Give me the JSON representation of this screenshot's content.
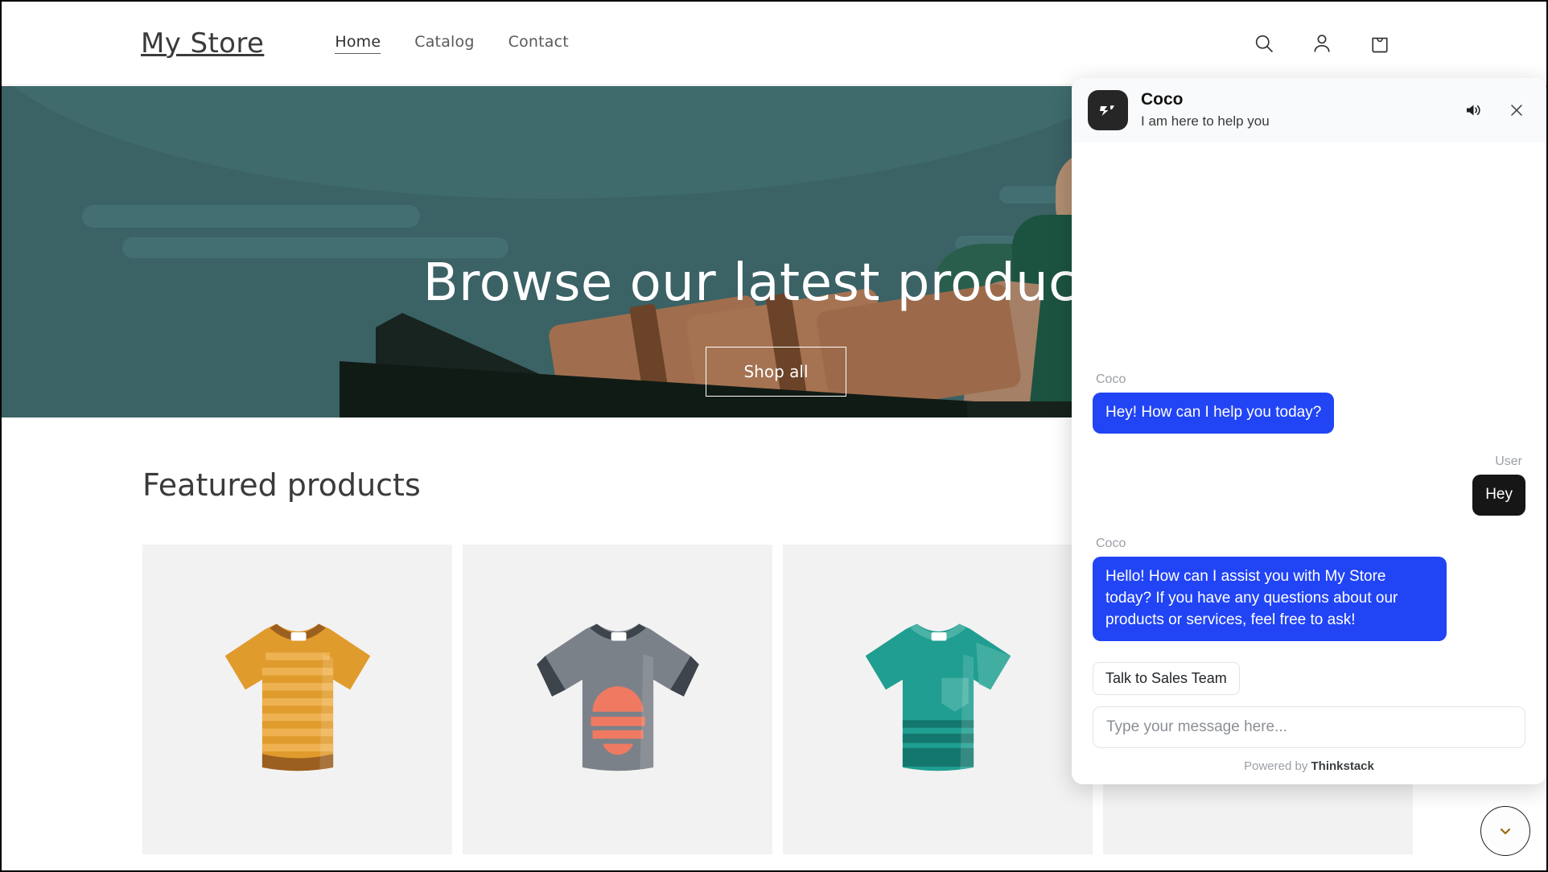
{
  "site": {
    "brand": "My Store",
    "nav": [
      {
        "label": "Home",
        "active": true
      },
      {
        "label": "Catalog",
        "active": false
      },
      {
        "label": "Contact",
        "active": false
      }
    ],
    "actions": [
      {
        "name": "search-icon",
        "label": "Search"
      },
      {
        "name": "account-icon",
        "label": "Log in"
      },
      {
        "name": "cart-icon",
        "label": "Cart"
      }
    ]
  },
  "hero": {
    "title": "Browse our latest products",
    "cta_label": "Shop all",
    "background_color": "#3b6265"
  },
  "featured": {
    "title": "Featured products",
    "products": [
      {
        "name": "striped-tee-yellow",
        "color": "#e09b2d"
      },
      {
        "name": "graphic-tee-gray",
        "color": "#7b8189"
      },
      {
        "name": "pocket-tee-teal",
        "color": "#1f9e91"
      },
      {
        "name": "product-placeholder",
        "color": "#f2f2f2"
      }
    ]
  },
  "chat": {
    "name": "Coco",
    "subtitle": "I am here to help you",
    "sound_label": "Sound",
    "close_label": "Close",
    "messages": [
      {
        "sender": "Coco",
        "side": "bot",
        "text": "Hey! How can I help you today?"
      },
      {
        "sender": "User",
        "side": "user",
        "text": "Hey"
      },
      {
        "sender": "Coco",
        "side": "bot",
        "text": "Hello! How can I assist you with My Store today? If you have any questions about our products or services, feel free to ask!"
      }
    ],
    "quick_replies": [
      "Talk to Sales Team"
    ],
    "input_placeholder": "Type your message here...",
    "input_value": "",
    "powered_prefix": "Powered by ",
    "powered_brand": "Thinkstack",
    "accent_color": "#2144f5"
  },
  "scroll_fab": {
    "label": "Scroll down",
    "icon": "chevron-down-icon"
  }
}
